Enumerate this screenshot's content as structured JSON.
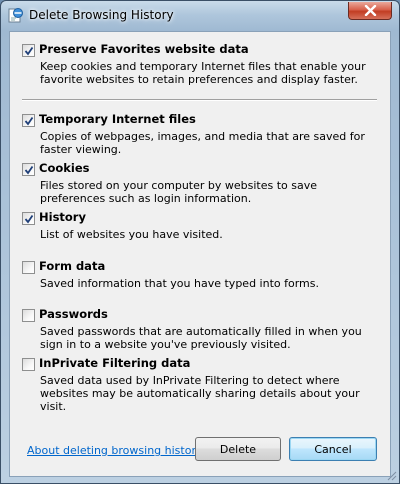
{
  "window": {
    "title": "Delete Browsing History"
  },
  "options": [
    {
      "title": "Preserve Favorites website data",
      "description": "Keep cookies and temporary Internet files that enable your favorite websites to retain preferences and display faster.",
      "checked": true
    },
    {
      "title": "Temporary Internet files",
      "description": "Copies of webpages, images, and media that are saved for faster viewing.",
      "checked": true
    },
    {
      "title": "Cookies",
      "description": "Files stored on your computer by websites to save preferences such as login information.",
      "checked": true
    },
    {
      "title": "History",
      "description": "List of websites you have visited.",
      "checked": true
    },
    {
      "title": "Form data",
      "description": "Saved information that you have typed into forms.",
      "checked": false
    },
    {
      "title": "Passwords",
      "description": "Saved passwords that are automatically filled in when you sign in to a website you've previously visited.",
      "checked": false
    },
    {
      "title": "InPrivate Filtering data",
      "description": "Saved data used by InPrivate Filtering to detect where websites may be automatically sharing details about your visit.",
      "checked": false
    }
  ],
  "footer": {
    "link_label": "About deleting browsing history",
    "delete_label": "Delete",
    "cancel_label": "Cancel"
  },
  "colors": {
    "link": "#0066cc",
    "close_button": "#c23d23",
    "dialog_background": "#f0f0f0"
  }
}
